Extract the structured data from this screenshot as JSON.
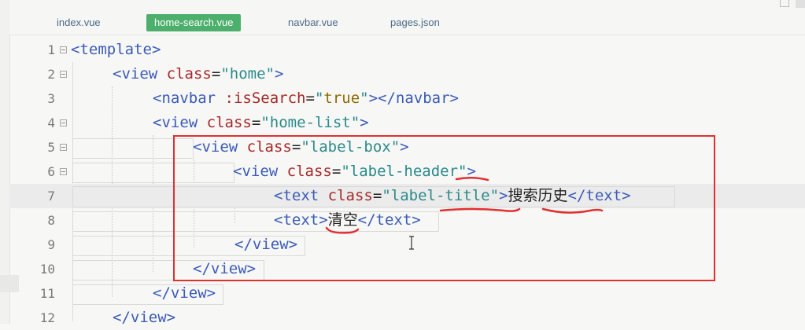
{
  "tabs": [
    {
      "label": "index.vue",
      "active": false
    },
    {
      "label": "home-search.vue",
      "active": true
    },
    {
      "label": "navbar.vue",
      "active": false
    },
    {
      "label": "pages.json",
      "active": false
    }
  ],
  "lines": [
    {
      "num": "1"
    },
    {
      "num": "2"
    },
    {
      "num": "3"
    },
    {
      "num": "4"
    },
    {
      "num": "5"
    },
    {
      "num": "6"
    },
    {
      "num": "7"
    },
    {
      "num": "8"
    },
    {
      "num": "9"
    },
    {
      "num": "10"
    },
    {
      "num": "11"
    },
    {
      "num": "12"
    }
  ],
  "code": {
    "l1": {
      "open": "<template>"
    },
    "l2": {
      "tag": "<view",
      "attr": "class",
      "eq": "=",
      "val": "\"home\"",
      "close": ">"
    },
    "l3": {
      "tag": "<navbar",
      "attr": ":isSearch",
      "eq": "=",
      "q1": "\"",
      "val": "true",
      "q2": "\"",
      "close": "></navbar>"
    },
    "l4": {
      "tag": "<view",
      "attr": "class",
      "eq": "=",
      "val": "\"home-list\"",
      "close": ">"
    },
    "l5": {
      "tag": "<view",
      "attr": "class",
      "eq": "=",
      "val": "\"label-box\"",
      "close": ">"
    },
    "l6": {
      "tag": "<view",
      "attr": "class",
      "eq": "=",
      "val": "\"label-header\"",
      "close": ">"
    },
    "l7": {
      "tag": "<text",
      "attr": "class",
      "eq": "=",
      "val": "\"label-title\"",
      "gt": ">",
      "text": "搜索历史",
      "close": "</text>"
    },
    "l8": {
      "tag": "<text",
      "gt": ">",
      "text": "清空",
      "close": "</text>"
    },
    "l9": {
      "close": "</view>"
    },
    "l10": {
      "close": "</view>"
    },
    "l11": {
      "close": "</view>"
    },
    "l12": {
      "close": "</view>"
    }
  },
  "colors": {
    "active_tab": "#4caf6b",
    "annotation": "#e13030",
    "tag": "#3b5bb8",
    "attribute": "#a52a2a",
    "string": "#2a8a8a"
  },
  "icons": {
    "fold": "fold-collapse-icon",
    "cursor": "text-cursor-icon"
  }
}
